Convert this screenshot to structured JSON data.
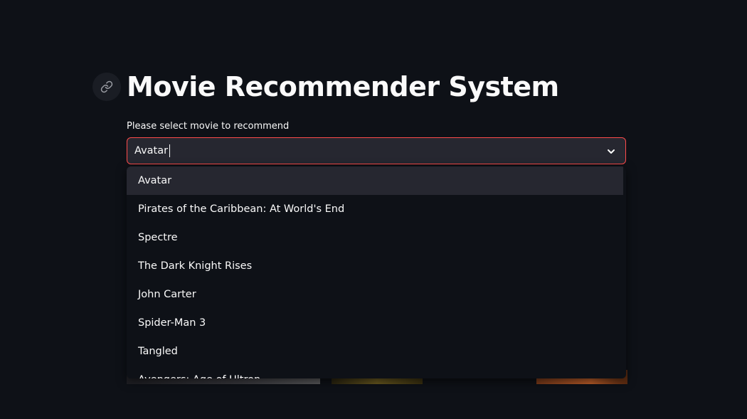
{
  "app": {
    "title": "Movie Recommender System"
  },
  "select": {
    "label": "Please select movie to recommend",
    "value": "Avatar",
    "icon": "chevron-down-icon"
  },
  "dropdown": {
    "options": [
      "Avatar",
      "Pirates of the Caribbean: At World's End",
      "Spectre",
      "The Dark Knight Rises",
      "John Carter",
      "Spider-Man 3",
      "Tangled",
      "Avengers: Age of Ultron"
    ],
    "highlighted_index": 0
  },
  "colors": {
    "background": "#0e1117",
    "input_bg": "#262730",
    "accent": "#ff4b4b",
    "text": "#fafafa"
  }
}
